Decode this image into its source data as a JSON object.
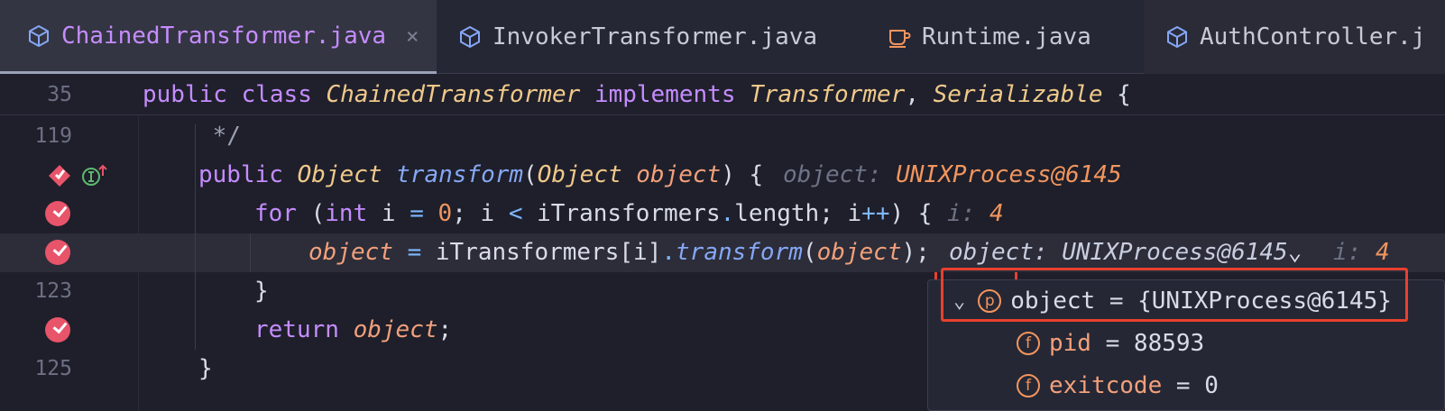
{
  "tabs": [
    {
      "label": "ChainedTransformer.java",
      "icon": "java-class-icon",
      "active": true,
      "close": "×"
    },
    {
      "label": "InvokerTransformer.java",
      "icon": "java-class-icon",
      "active": false
    },
    {
      "label": "Runtime.java",
      "icon": "java-coffee-icon",
      "active": false
    },
    {
      "label": "AuthController.j",
      "icon": "java-class-icon",
      "active": false
    }
  ],
  "sticky": {
    "line_number": "35",
    "kw_public": "public",
    "kw_class": "class",
    "class_name": "ChainedTransformer",
    "kw_implements": "implements",
    "iface1": "Transformer",
    "comma": ",",
    "iface2": "Serializable",
    "brace": "{"
  },
  "lines": {
    "l119": {
      "num": "119",
      "text": " */"
    },
    "l120": {
      "kw": "public",
      "type1": "Object",
      "method": "transform",
      "paren_open": "(",
      "type2": "Object",
      "param": "object",
      "paren_close": ")",
      "brace": "{",
      "hint_key": "object:",
      "hint_val": "UNIXProcess@6145"
    },
    "l121": {
      "kw_for": "for",
      "p1": "(",
      "kw_int": "int",
      "i1": "i",
      "eq": "=",
      "zero": "0",
      "semi1": ";",
      "i2": "i",
      "lt": "<",
      "field": "iTransformers",
      "dot": ".",
      "length": "length",
      "semi2": ";",
      "i3": "i",
      "inc": "++",
      "p2": ")",
      "brace": "{",
      "hint_key": "i:",
      "hint_val": "4"
    },
    "l122": {
      "var": "object",
      "eq": "=",
      "field": "iTransformers",
      "idx": "[i]",
      "dot": ".",
      "method": "transform",
      "p1": "(",
      "arg": "object",
      "p2": ");",
      "inline_key": "object:",
      "inline_val": "UNIXProcess@6145",
      "chevron": "⌄",
      "i_key": "i:",
      "i_val": "4"
    },
    "l123": {
      "num": "123",
      "text": "}"
    },
    "l124": {
      "kw_return": "return",
      "var": "object",
      "semi": ";"
    },
    "l125": {
      "num": "125",
      "text": "}"
    }
  },
  "popup": {
    "root": {
      "chevron": "⌄",
      "badge": "p",
      "text": "object = {UNIXProcess@6145}"
    },
    "fields": [
      {
        "badge": "f",
        "name": "pid",
        "value": "= 88593"
      },
      {
        "badge": "f",
        "name": "exitcode",
        "value": "= 0"
      }
    ]
  },
  "colors": {
    "background": "#1e1f2a",
    "keyword": "#c58cff",
    "type": "#f0c98a",
    "method": "#86a7f5",
    "variable": "#f2a07b",
    "number": "#f2955e",
    "breakpoint": "#e8546a",
    "highlight_box": "#e8402e"
  }
}
